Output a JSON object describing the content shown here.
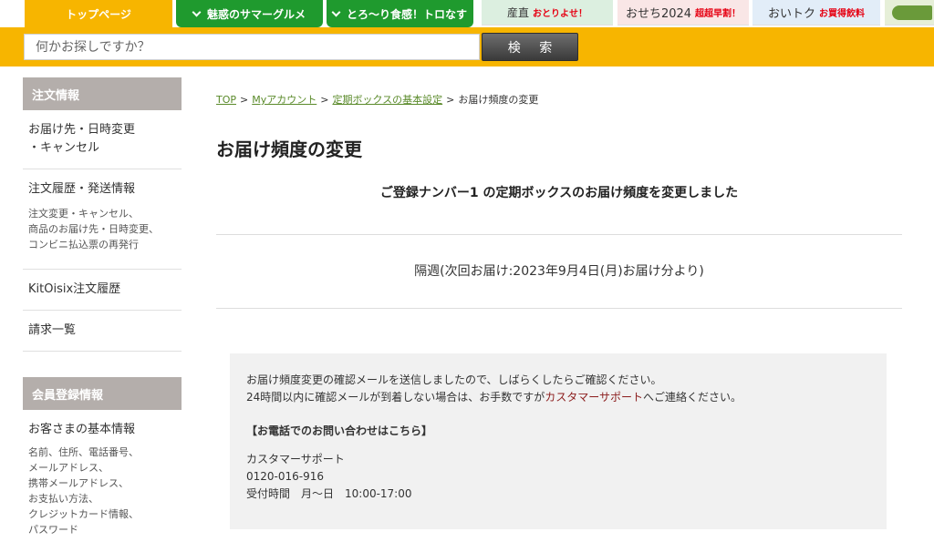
{
  "nav": {
    "home": "トップページ",
    "gourmet": "魅惑のサマーグルメ",
    "toro": "とろ〜り食感！トロなす",
    "sanchoku": "産直",
    "sanchoku_sub": "おとりよせ！",
    "osechi": "おせち2024",
    "osechi_sub": "超超早割！",
    "oitoku": "おいトク",
    "oitoku_sub": "お買得飲料"
  },
  "search": {
    "placeholder": "何かお探しですか？",
    "button_label": "検 索"
  },
  "sidebar": {
    "order_heading": "注文情報",
    "delivery_change_line1": "お届け先・日時変更",
    "delivery_change_line2": "・キャンセル",
    "order_history": "注文履歴・発送情報",
    "order_history_desc1": "注文変更・キャンセル、",
    "order_history_desc2": "商品のお届け先・日時変更、",
    "order_history_desc3": "コンビニ払込票の再発行",
    "kitoisix_history": "KitOisix注文履歴",
    "billing": "請求一覧",
    "member_heading": "会員登録情報",
    "basic_info": "お客さまの基本情報",
    "basic_desc1": "名前、住所、電話番号、",
    "basic_desc2": "メールアドレス、",
    "basic_desc3": "携帯メールアドレス、",
    "basic_desc4": "お支払い方法、",
    "basic_desc5": "クレジットカード情報、",
    "basic_desc6": "パスワード"
  },
  "breadcrumb": {
    "top": "TOP",
    "separator": ">",
    "account": "Myアカウント",
    "box_settings": "定期ボックスの基本設定",
    "current": "お届け頻度の変更"
  },
  "main": {
    "title": "お届け頻度の変更",
    "message": "ご登録ナンバー1 の定期ボックスのお届け頻度を変更しました",
    "frequency": "隔週(次回お届け:2023年9月4日(月)お届け分より)"
  },
  "info": {
    "line1": "お届け頻度変更の確認メールを送信しましたので、しばらくしたらご確認ください。",
    "line2_pre": "24時間以内に確認メールが到着しない場合は、お手数ですが",
    "line2_link": "カスタマーサポート",
    "line2_post": "へご連絡ください。",
    "phone_heading": "【お電話でのお問い合わせはこちら】",
    "support_name": "カスタマーサポート",
    "phone_number": "0120-016-916",
    "hours": "受付時間　月〜日　10:00-17:00"
  },
  "colors": {
    "brand_yellow": "#f7b500",
    "nav_green": "#1f9a2e",
    "sidebar_heading": "#b4aeab",
    "link_green": "#5a8a2a",
    "link_red": "#8b1c1c"
  }
}
